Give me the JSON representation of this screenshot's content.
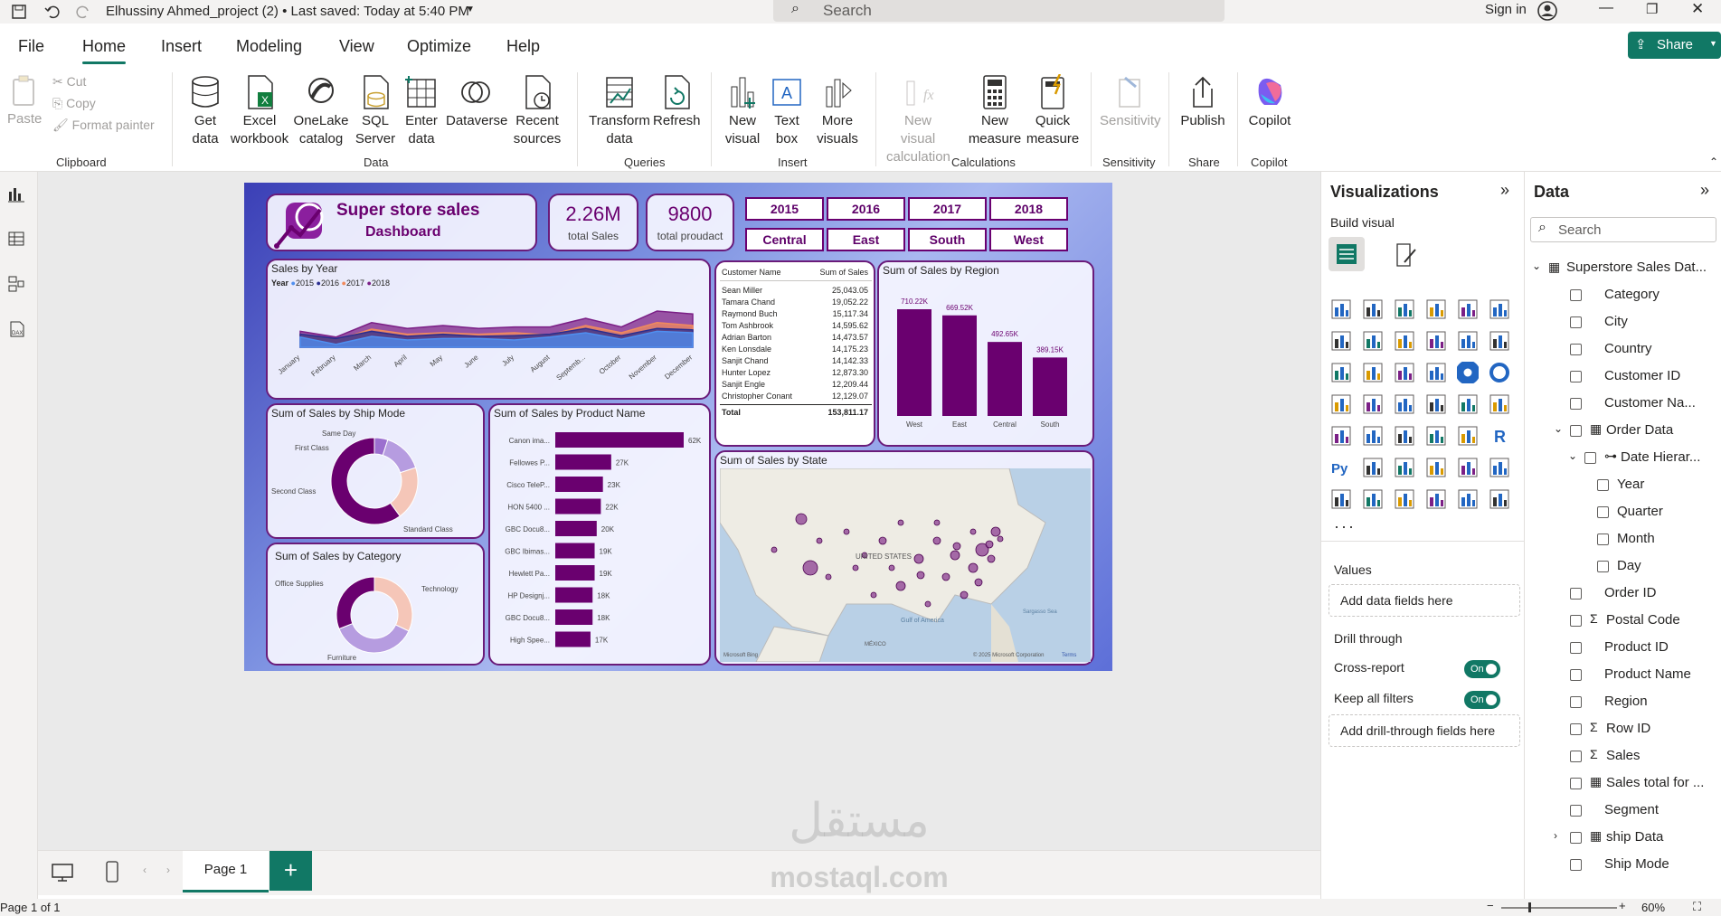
{
  "titlebar": {
    "title": "Elhussiny Ahmed_project (2) • Last saved: Today at 5:40 PM",
    "search_placeholder": "Search",
    "signin": "Sign in"
  },
  "menu": {
    "tabs": [
      "File",
      "Home",
      "Insert",
      "Modeling",
      "View",
      "Optimize",
      "Help"
    ],
    "share": "Share"
  },
  "ribbon": {
    "clipboard": {
      "paste": "Paste",
      "cut": "Cut",
      "copy": "Copy",
      "format_painter": "Format painter",
      "group": "Clipboard"
    },
    "data": {
      "get_data": "Get data",
      "excel": "Excel workbook",
      "onelake": "OneLake catalog",
      "sql": "SQL Server",
      "enter": "Enter data",
      "dataverse": "Dataverse",
      "recent": "Recent sources",
      "group": "Data"
    },
    "queries": {
      "transform": "Transform data",
      "refresh": "Refresh",
      "group": "Queries"
    },
    "insert": {
      "new_visual": "New visual",
      "text_box": "Text box",
      "more_visuals": "More visuals",
      "group": "Insert"
    },
    "calculations": {
      "new_visual_calc": "New visual calculation",
      "new_measure": "New measure",
      "quick_measure": "Quick measure",
      "group": "Calculations"
    },
    "sensitivity": {
      "label": "Sensitivity",
      "group": "Sensitivity"
    },
    "share": {
      "publish": "Publish",
      "group": "Share"
    },
    "copilot": {
      "label": "Copilot",
      "group": "Copilot"
    }
  },
  "report": {
    "header_title": "Super store sales",
    "header_sub": "Dashboard",
    "kpi_sales_value": "2.26M",
    "kpi_sales_label": "total Sales",
    "kpi_product_value": "9800",
    "kpi_product_label": "total proudact",
    "years": [
      "2015",
      "2016",
      "2017",
      "2018"
    ],
    "regions": [
      "Central",
      "East",
      "South",
      "West"
    ],
    "sales_by_year_title": "Sales by Year",
    "legend_title": "Year",
    "month_labels": [
      "January",
      "February",
      "March",
      "April",
      "May",
      "June",
      "July",
      "August",
      "Septemb...",
      "October",
      "November",
      "December"
    ],
    "ship_title": "Sum of Sales by Ship Mode",
    "ship_labels": [
      "Same Day",
      "First Class",
      "Second Class",
      "Standard Class"
    ],
    "product_title": "Sum of Sales by Product Name",
    "region_title": "Sum of Sales by Region",
    "state_title": "Sum of Sales by State",
    "map_labels": {
      "us": "UNITED STATES",
      "mexico": "MÉXICO",
      "gulf": "Gulf of America",
      "sargasso": "Sargasso Sea",
      "brand": "Microsoft Bing",
      "copyright": "© 2025 Microsoft Corporation",
      "terms": "Terms"
    },
    "category_title": "Sum of Sales by Category",
    "category_labels": [
      "Office Supplies",
      "Technology",
      "Furniture"
    ],
    "table": {
      "headers": [
        "Customer Name",
        "Sum of Sales"
      ],
      "rows": [
        [
          "Sean Miller",
          "25,043.05"
        ],
        [
          "Tamara Chand",
          "19,052.22"
        ],
        [
          "Raymond Buch",
          "15,117.34"
        ],
        [
          "Tom Ashbrook",
          "14,595.62"
        ],
        [
          "Adrian Barton",
          "14,473.57"
        ],
        [
          "Ken Lonsdale",
          "14,175.23"
        ],
        [
          "Sanjit Chand",
          "14,142.33"
        ],
        [
          "Hunter Lopez",
          "12,873.30"
        ],
        [
          "Sanjit Engle",
          "12,209.44"
        ],
        [
          "Christopher Conant",
          "12,129.07"
        ]
      ],
      "total_label": "Total",
      "total_value": "153,811.17"
    }
  },
  "chart_data": [
    {
      "type": "area",
      "title": "Sales by Year",
      "legend_title": "Year",
      "categories": [
        "January",
        "February",
        "March",
        "April",
        "May",
        "June",
        "July",
        "August",
        "Septemb...",
        "October",
        "November",
        "December"
      ],
      "series": [
        {
          "name": "2015",
          "values": [
            14,
            4,
            15,
            10,
            12,
            12,
            10,
            14,
            20,
            11,
            22,
            20
          ]
        },
        {
          "name": "2016",
          "values": [
            18,
            12,
            22,
            15,
            18,
            15,
            16,
            18,
            26,
            16,
            26,
            24
          ]
        },
        {
          "name": "2017",
          "values": [
            18,
            10,
            25,
            18,
            20,
            18,
            20,
            17,
            30,
            20,
            34,
            30
          ]
        },
        {
          "name": "2018",
          "values": [
            22,
            14,
            34,
            26,
            30,
            26,
            28,
            28,
            40,
            28,
            50,
            46
          ]
        }
      ],
      "colors": [
        "#4f8ff0",
        "#2b2d8f",
        "#f08a5d",
        "#7b1f86"
      ]
    },
    {
      "type": "pie",
      "title": "Sum of Sales by Ship Mode",
      "categories": [
        "Same Day",
        "First Class",
        "Second Class",
        "Standard Class"
      ],
      "values": [
        5,
        15,
        20,
        60
      ],
      "colors": [
        "#9c6fcf",
        "#b69ce0",
        "#f5c6b8",
        "#6a006f"
      ]
    },
    {
      "type": "bar",
      "title": "Sum of Sales by Product Name",
      "categories": [
        "Canon ima...",
        "Fellowes P...",
        "Cisco TeleP...",
        "HON 5400 ...",
        "GBC Docu8...",
        "GBC Ibimas...",
        "Hewlett Pa...",
        "HP Designj...",
        "GBC Docu8...",
        "High Spee..."
      ],
      "values": [
        62,
        27,
        23,
        22,
        20,
        19,
        19,
        18,
        18,
        17
      ],
      "data_labels": [
        "62K",
        "27K",
        "23K",
        "22K",
        "20K",
        "19K",
        "19K",
        "18K",
        "18K",
        "17K"
      ]
    },
    {
      "type": "bar",
      "title": "Sum of Sales by Region",
      "categories": [
        "West",
        "East",
        "Central",
        "South"
      ],
      "values": [
        710.22,
        669.52,
        492.65,
        389.15
      ],
      "data_labels": [
        "710.22K",
        "669.52K",
        "492.65K",
        "389.15K"
      ]
    },
    {
      "type": "pie",
      "title": "Sum of Sales by Category",
      "categories": [
        "Office Supplies",
        "Technology",
        "Furniture"
      ],
      "values": [
        32,
        37,
        31
      ],
      "colors": [
        "#f5c6b8",
        "#b69ce0",
        "#6a006f"
      ]
    }
  ],
  "pages": {
    "current": "Page 1",
    "status": "Page 1 of 1",
    "zoom": "60%"
  },
  "viz": {
    "title": "Visualizations",
    "build": "Build visual",
    "values": "Values",
    "add_values": "Add data fields here",
    "drill": "Drill through",
    "cross": "Cross-report",
    "keep": "Keep all filters",
    "on": "On",
    "add_drill": "Add drill-through fields here"
  },
  "data_pane": {
    "title": "Data",
    "search": "Search",
    "fields": [
      "Superstore Sales Dat...",
      "Category",
      "City",
      "Country",
      "Customer ID",
      "Customer Na...",
      "Order Data",
      "Date Hierar...",
      "Year",
      "Quarter",
      "Month",
      "Day",
      "Order ID",
      "Postal Code",
      "Product ID",
      "Product Name",
      "Region",
      "Row ID",
      "Sales",
      "Sales total for ...",
      "Segment",
      "ship Data",
      "Ship Mode"
    ]
  },
  "watermark": {
    "arabic": "مستقل",
    "latin": "mostaql.com"
  }
}
